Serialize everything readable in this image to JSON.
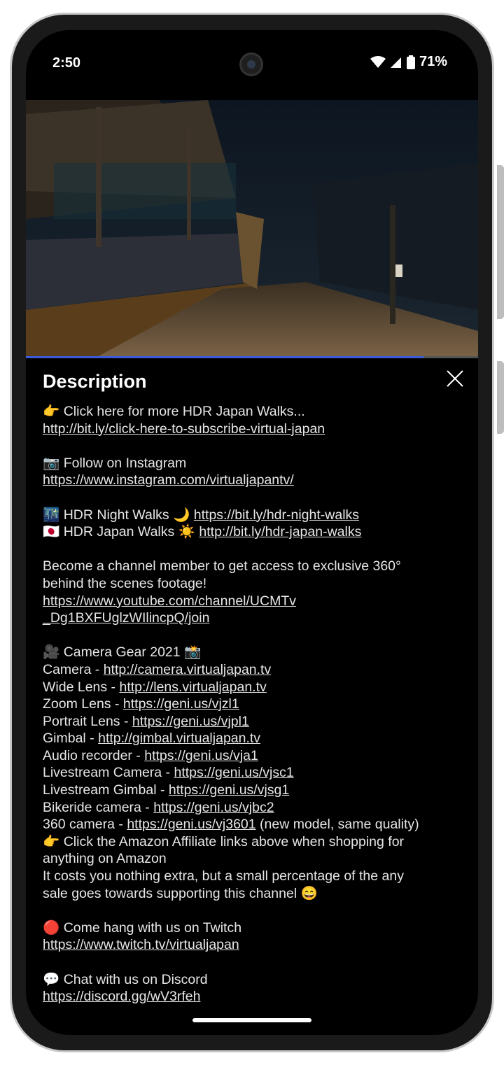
{
  "status": {
    "time": "2:50",
    "battery": "71%"
  },
  "panel": {
    "title": "Description"
  },
  "desc": {
    "l1": "👉 Click here for more HDR Japan Walks...",
    "l2": "http://bit.ly/click-here-to-subscribe-virtual-japan",
    "l3": "📷 Follow on Instagram",
    "l4": "https://www.instagram.com/virtualjapantv/",
    "l5a": "🌃 HDR Night Walks 🌙 ",
    "l5b": "https://bit.ly/hdr-night-walks",
    "l6a": "🇯🇵 HDR Japan Walks ☀️ ",
    "l6b": "http://bit.ly/hdr-japan-walks",
    "l7": "Become a channel member to get access to exclusive 360°",
    "l8": "behind the scenes footage!",
    "l9": "https://www.youtube.com/channel/UCMTv",
    "l10": "_Dg1BXFUglzWIlincpQ/join",
    "l11": "🎥 Camera Gear 2021 📸",
    "gear": [
      {
        "label": "Camera - ",
        "link": "http://camera.virtualjapan.tv",
        "suffix": ""
      },
      {
        "label": "Wide Lens - ",
        "link": "http://lens.virtualjapan.tv",
        "suffix": ""
      },
      {
        "label": "Zoom Lens - ",
        "link": "https://geni.us/vjzl1",
        "suffix": ""
      },
      {
        "label": "Portrait Lens - ",
        "link": "https://geni.us/vjpl1",
        "suffix": ""
      },
      {
        "label": "Gimbal - ",
        "link": "http://gimbal.virtualjapan.tv",
        "suffix": ""
      },
      {
        "label": "Audio recorder - ",
        "link": "https://geni.us/vja1",
        "suffix": ""
      },
      {
        "label": "Livestream Camera - ",
        "link": "https://geni.us/vjsc1",
        "suffix": ""
      },
      {
        "label": "Livestream Gimbal - ",
        "link": "https://geni.us/vjsg1",
        "suffix": ""
      },
      {
        "label": "Bikeride camera - ",
        "link": "https://geni.us/vjbc2",
        "suffix": ""
      },
      {
        "label": "360 camera - ",
        "link": "https://geni.us/vj3601",
        "suffix": " (new model, same quality)"
      }
    ],
    "l12": "👉 Click the Amazon Affiliate links above when shopping for",
    "l13": "anything on Amazon",
    "l14": "It costs you nothing extra, but a small percentage of the any",
    "l15": "sale goes towards supporting this channel 😄",
    "l16": "🔴 Come hang with us on Twitch",
    "l17": "https://www.twitch.tv/virtualjapan",
    "l18": "💬 Chat with us on Discord",
    "l19": "https://discord.gg/wV3rfeh"
  },
  "video": {
    "progress": 0.88
  }
}
